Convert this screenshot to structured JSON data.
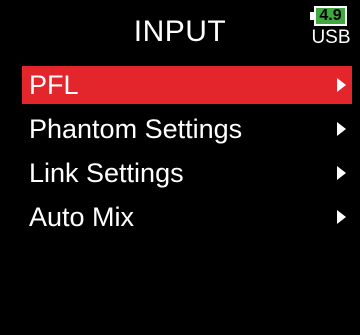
{
  "header": {
    "title": "INPUT"
  },
  "battery": {
    "level": "4.9",
    "source": "USB",
    "color": "#3fa83f"
  },
  "menu": {
    "selected_index": 0,
    "selected_color": "#e3262b",
    "items": [
      {
        "label": "PFL",
        "icon": "right-arrow-icon"
      },
      {
        "label": "Phantom Settings",
        "icon": "right-arrow-icon"
      },
      {
        "label": "Link Settings",
        "icon": "right-arrow-icon"
      },
      {
        "label": "Auto Mix",
        "icon": "right-arrow-icon"
      }
    ]
  }
}
